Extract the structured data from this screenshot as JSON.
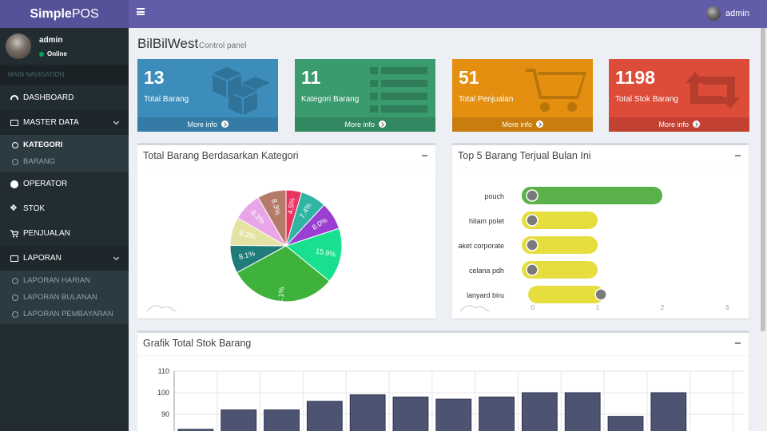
{
  "app": {
    "logo_bold": "Simple",
    "logo_rest": "POS"
  },
  "navbar": {
    "username": "admin"
  },
  "sidebar": {
    "user": {
      "name": "admin",
      "status": "Online"
    },
    "header": "MAIN NAVIGATION",
    "items": [
      {
        "label": "DASHBOARD"
      },
      {
        "label": "MASTER DATA",
        "sub": [
          "KATEGORI",
          "BARANG"
        ]
      },
      {
        "label": "OPERATOR"
      },
      {
        "label": "STOK"
      },
      {
        "label": "PENJUALAN"
      },
      {
        "label": "LAPORAN",
        "sub": [
          "LAPORAN HARIAN",
          "LAPORAN BULANAN",
          "LAPORAN PEMBAYARAN"
        ]
      }
    ]
  },
  "page": {
    "title": "BilBilWest",
    "subtitle": "Control panel"
  },
  "stats": [
    {
      "value": "13",
      "label": "Total Barang",
      "link": "More info",
      "color": "#3c8dbc",
      "icon": "cubes-icon"
    },
    {
      "value": "11",
      "label": "Kategori Barang",
      "link": "More info",
      "color": "#3a9b6e",
      "icon": "list-icon"
    },
    {
      "value": "51",
      "label": "Total Penjualan",
      "link": "More info",
      "color": "#e48f0f",
      "icon": "cart-icon"
    },
    {
      "value": "1198",
      "label": "Total Stok Barang",
      "link": "More info",
      "color": "#dd4b39",
      "icon": "retweet-icon"
    }
  ],
  "panels": {
    "pie": {
      "title": "Total Barang Berdasarkan Kategori"
    },
    "top5": {
      "title": "Top 5 Barang Terjual Bulan Ini"
    },
    "stok": {
      "title": "Grafik Total Stok Barang"
    }
  },
  "chart_data": [
    {
      "type": "pie",
      "title": "Total Barang Berdasarkan Kategori",
      "slices": [
        {
          "label": "4.5%",
          "value": 4.5,
          "color": "#e8345e"
        },
        {
          "label": "7.4%",
          "value": 7.4,
          "color": "#2fb5a1"
        },
        {
          "label": "8.0%",
          "value": 8.0,
          "color": "#9a3fd1"
        },
        {
          "label": "15.9%",
          "value": 15.9,
          "color": "#19e08e"
        },
        {
          "label": "31.1%",
          "value": 31.1,
          "color": "#3fb23c"
        },
        {
          "label": "8.1%",
          "value": 8.1,
          "color": "#1f7c78"
        },
        {
          "label": "8.2%",
          "value": 8.2,
          "color": "#e5e3a4"
        },
        {
          "label": "8.3%",
          "value": 8.3,
          "color": "#e8a6e6"
        },
        {
          "label": "8.3%",
          "value": 8.3,
          "color": "#b57b69"
        }
      ]
    },
    {
      "type": "bar",
      "title": "Top 5 Barang Terjual Bulan Ini",
      "orientation": "horizontal",
      "categories": [
        "pouch",
        "hitam polet",
        "aket corporate",
        "celana pdh",
        "lanyard biru"
      ],
      "values": [
        2,
        1,
        1,
        1,
        1
      ],
      "colors": [
        "#5ab14a",
        "#e6de3e",
        "#e6de3e",
        "#e6de3e",
        "#e6de3e"
      ],
      "x_ticks": [
        "0",
        "1",
        "2",
        "3"
      ],
      "xlim": [
        0,
        3
      ]
    },
    {
      "type": "bar",
      "title": "Grafik Total Stok Barang",
      "values": [
        83,
        92,
        92,
        96,
        99,
        98,
        97,
        98,
        100,
        100,
        89,
        100
      ],
      "y_ticks": [
        "110",
        "100",
        "90"
      ],
      "ylim": [
        80,
        110
      ],
      "color": "#4d5472"
    }
  ]
}
